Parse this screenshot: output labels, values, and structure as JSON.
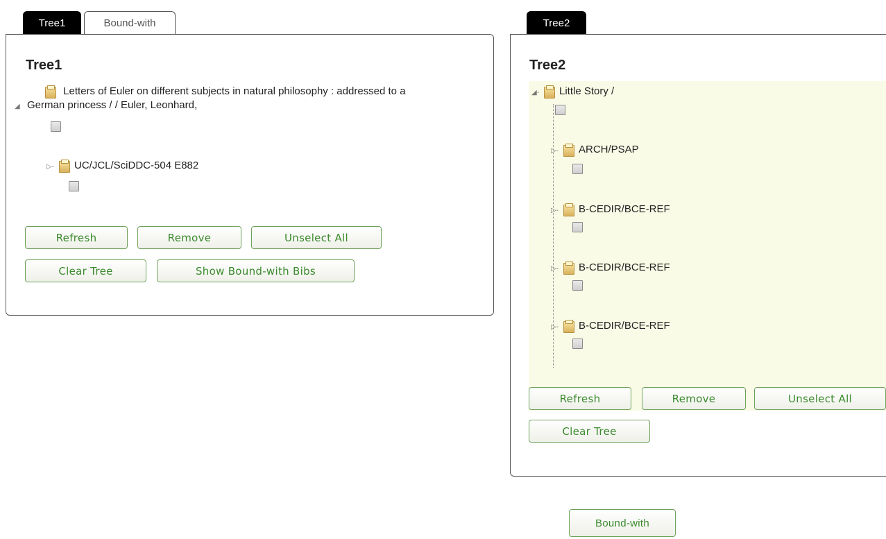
{
  "tree1": {
    "tabs": [
      {
        "label": "Tree1"
      },
      {
        "label": "Bound-with"
      }
    ],
    "title": "Tree1",
    "nodes": [
      {
        "label_line1": "Letters of Euler on different subjects in natural philosophy : addressed to a",
        "label_line2": "German princess / / Euler, Leonhard,"
      },
      {
        "label": "UC/JCL/SciDDC-504 E882"
      }
    ],
    "buttons": {
      "refresh": "Refresh",
      "remove": "Remove",
      "unselect_all": "Unselect All",
      "clear_tree": "Clear Tree",
      "show_bound_with": "Show Bound-with Bibs"
    }
  },
  "tree2": {
    "tabs": [
      {
        "label": "Tree2"
      }
    ],
    "title": "Tree2",
    "root": {
      "label": "Little Story /"
    },
    "children": [
      {
        "label": "ARCH/PSAP"
      },
      {
        "label": "B-CEDIR/BCE-REF"
      },
      {
        "label": "B-CEDIR/BCE-REF"
      },
      {
        "label": "B-CEDIR/BCE-REF"
      }
    ],
    "buttons": {
      "refresh": "Refresh",
      "remove": "Remove",
      "unselect_all": "Unselect All",
      "clear_tree": "Clear Tree"
    }
  },
  "footer": {
    "bound_with_button": "Bound-with"
  },
  "colors": {
    "accent_green": "#3b8a2e",
    "tree2_background": "#fafbe6",
    "tab_active": "#000000"
  },
  "icons": [
    "folder-icon",
    "expand-toggle-icon",
    "collapse-toggle-icon",
    "checkbox"
  ]
}
